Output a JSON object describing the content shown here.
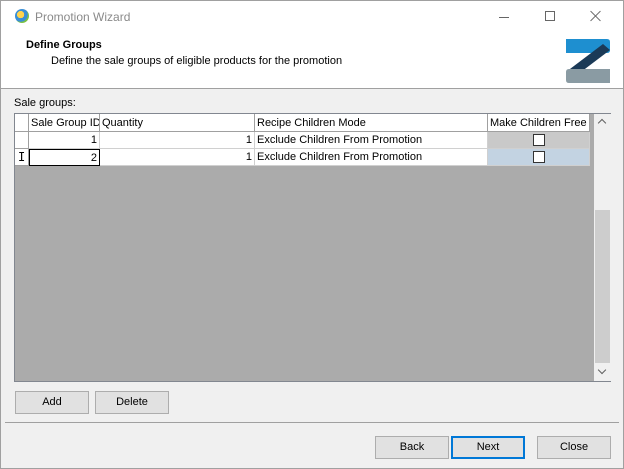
{
  "window": {
    "title": "Promotion Wizard"
  },
  "header": {
    "title": "Define Groups",
    "subtitle": "Define the sale groups of eligible products for the promotion"
  },
  "sale_groups_label": "Sale groups:",
  "grid": {
    "columns": [
      "Sale Group ID",
      "Quantity",
      "Recipe Children Mode",
      "Make Children Free"
    ],
    "rows": [
      {
        "sale_group_id": "1",
        "quantity": "1",
        "recipe_children_mode": "Exclude Children From Promotion",
        "make_children_free": false
      },
      {
        "sale_group_id": "2",
        "quantity": "1",
        "recipe_children_mode": "Exclude Children From Promotion",
        "make_children_free": false
      }
    ],
    "edit_cursor": "I"
  },
  "buttons": {
    "add": "Add",
    "delete": "Delete",
    "back": "Back",
    "next": "Next",
    "close": "Close"
  },
  "colors": {
    "logo_blue": "#1e8fd0",
    "logo_navy": "#1b3a57",
    "logo_gray": "#8a9ba3",
    "selected_cell": "#c3d3e2",
    "focus_border": "#0078d7"
  }
}
